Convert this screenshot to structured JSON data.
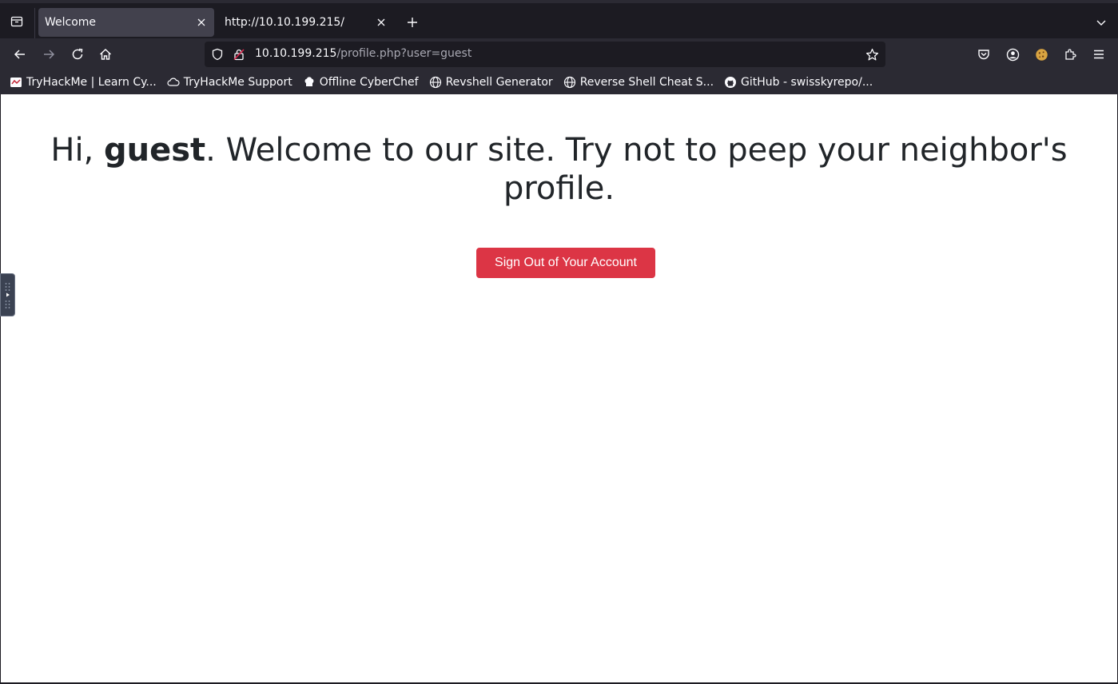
{
  "browser": {
    "tabs": [
      {
        "label": "Welcome",
        "active": true
      },
      {
        "label": "http://10.10.199.215/",
        "active": false
      }
    ],
    "url": {
      "host": "10.10.199.215",
      "path": "/profile.php?user=guest"
    },
    "bookmarks": [
      {
        "label": "TryHackMe | Learn Cy...",
        "icon": "tryhackme-icon"
      },
      {
        "label": "TryHackMe Support",
        "icon": "cloud-icon"
      },
      {
        "label": "Offline CyberChef",
        "icon": "chef-icon"
      },
      {
        "label": "Revshell Generator",
        "icon": "globe-icon"
      },
      {
        "label": "Reverse Shell Cheat S...",
        "icon": "globe-icon"
      },
      {
        "label": "GitHub - swisskyrepo/...",
        "icon": "github-icon"
      }
    ]
  },
  "page": {
    "greeting_prefix": "Hi, ",
    "username": "guest",
    "greeting_suffix": ". Welcome to our site. Try not to peep your neighbor's profile.",
    "signout_label": "Sign Out of Your Account"
  },
  "colors": {
    "danger": "#dc3545",
    "text": "#212529",
    "chrome_dark": "#1c1b22",
    "chrome": "#2b2a33",
    "tab_active": "#42414d"
  }
}
